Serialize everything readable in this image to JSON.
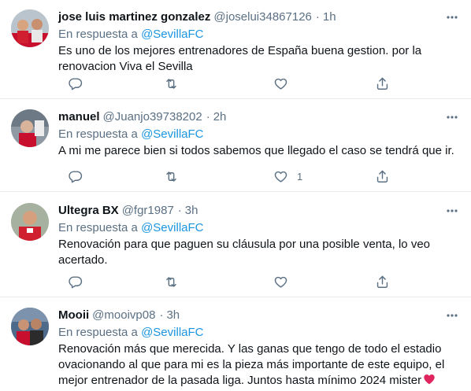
{
  "reply_prefix": "En respuesta a",
  "colors": {
    "accent": "#1b95e0",
    "secondary_text": "#5b7083",
    "divider": "#e6ecf0",
    "heart": "#e0245e"
  },
  "tweets": [
    {
      "name": "jose luis martinez gonzalez",
      "handle": "@joselui34867126",
      "dot": "·",
      "time": "1h",
      "reply_to": "@SevillaFC",
      "text": "Es uno de los mejores entrenadores de España buena gestion. por la renovacion Viva el Sevilla",
      "like_count": ""
    },
    {
      "name": "manuel",
      "handle": "@Juanjo39738202",
      "dot": "·",
      "time": "2h",
      "reply_to": "@SevillaFC",
      "text": "A mi me parece bien si todos sabemos que llegado el caso se tendrá que ir.",
      "like_count": "1"
    },
    {
      "name": "Ultegra BX",
      "handle": "@fgr1987",
      "dot": "·",
      "time": "3h",
      "reply_to": "@SevillaFC",
      "text": "Renovación para que paguen su cláusula por una posible venta, lo veo acertado.",
      "like_count": ""
    },
    {
      "name": "Mooii",
      "handle": "@mooivp08",
      "dot": "·",
      "time": "3h",
      "reply_to": "@SevillaFC",
      "text": "Renovación más que merecida. Y las ganas que tengo de todo el estadio ovacionando al que para mi es la pieza más importante de este equipo, el mejor entrenador de la pasada liga. Juntos hasta mínimo 2024 mister",
      "emoji": "heart-emoji"
    }
  ]
}
